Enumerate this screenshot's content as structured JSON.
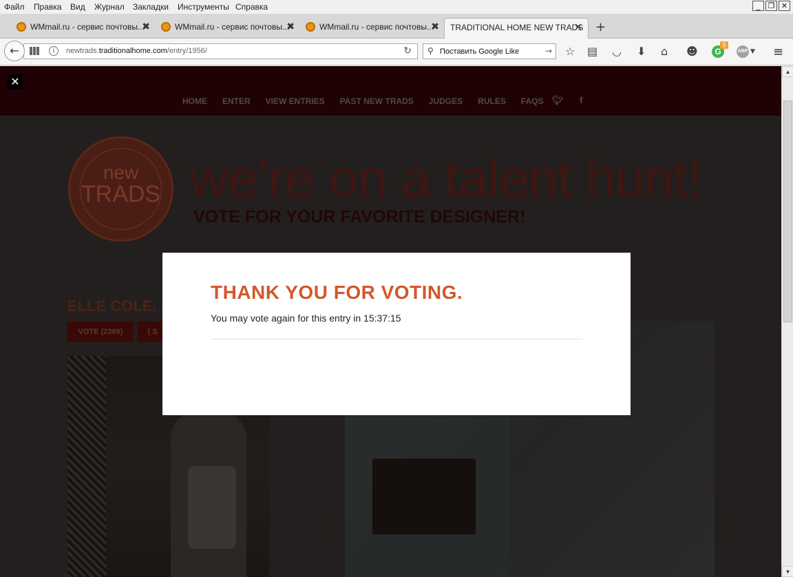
{
  "menubar": {
    "items": [
      "Файл",
      "Правка",
      "Вид",
      "Журнал",
      "Закладки",
      "Инструменты",
      "Справка"
    ]
  },
  "window_controls": {
    "minimize": "_",
    "maximize": "❐",
    "close": "✕"
  },
  "tabs": [
    {
      "title": "WMmail.ru - сервис почтовы...",
      "close": "✖"
    },
    {
      "title": "WMmail.ru - сервис почтовы...",
      "close": "✖"
    },
    {
      "title": "WMmail.ru - сервис почтовы...",
      "close": "✖"
    },
    {
      "title": "TRADITIONAL HOME NEW TRADS",
      "close": "✕"
    }
  ],
  "new_tab": "+",
  "address": {
    "prefix": "newtrads.",
    "domain": "traditionalhome.com",
    "path": "/entry/1956/"
  },
  "search": {
    "value": "Поставить Google Like"
  },
  "toolbar_icons": [
    "star-icon",
    "reading-list-icon",
    "pocket-icon",
    "download-icon",
    "home-icon",
    "chat-icon",
    "grammarly-icon",
    "adblock-icon",
    "menu-icon"
  ],
  "grammarly_badge": "5",
  "adblock_label": "ABP",
  "site": {
    "close_label": "✕",
    "nav": [
      "HOME",
      "ENTER",
      "VIEW ENTRIES",
      "PAST NEW TRADS",
      "JUDGES",
      "RULES",
      "FAQS"
    ],
    "logo_word1": "new",
    "logo_word2": "TRADS",
    "headline": "we’re on a talent hunt!",
    "tagline": "VOTE FOR YOUR FAVORITE DESIGNER!",
    "entry_name": "ELLE COLE. A",
    "vote_button": "VOTE (2389)",
    "share_button": "S",
    "arrow_prev": "‹",
    "arrow_next": "›"
  },
  "modal": {
    "title": "THANK YOU FOR VOTING.",
    "message": "You may vote again for this entry in 15:37:15"
  },
  "colors": {
    "accent": "#d2582a",
    "site_nav_bg": "#200204"
  }
}
